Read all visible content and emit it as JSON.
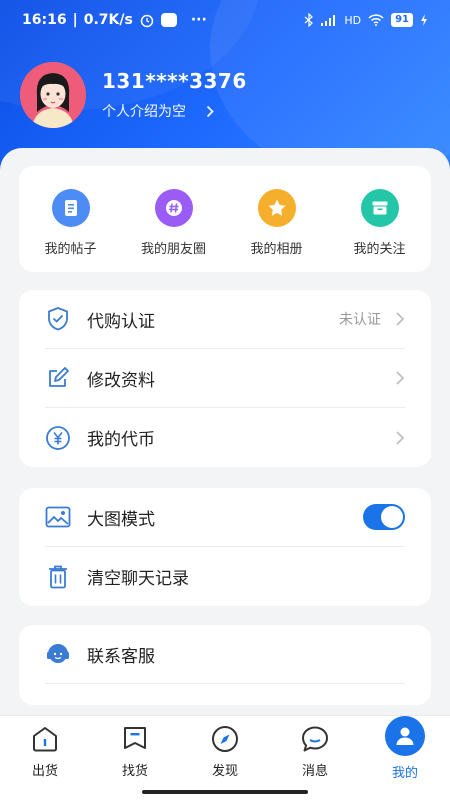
{
  "statusbar": {
    "time": "16:16",
    "speed": "0.7K/s",
    "battery": "91",
    "more": "···",
    "net": "HD"
  },
  "profile": {
    "name": "131****3376",
    "bio": "个人介绍为空"
  },
  "quick_actions": [
    {
      "label": "我的帖子",
      "icon": "document-icon",
      "color": "#4d8bf5"
    },
    {
      "label": "我的朋友圈",
      "icon": "hashtag-icon",
      "color": "#9b5cf6"
    },
    {
      "label": "我的相册",
      "icon": "star-icon",
      "color": "#f6ae2d"
    },
    {
      "label": "我的关注",
      "icon": "archive-icon",
      "color": "#24c6a8"
    }
  ],
  "account_list": [
    {
      "label": "代购认证",
      "value": "未认证",
      "icon": "shield-check-icon"
    },
    {
      "label": "修改资料",
      "value": "",
      "icon": "edit-icon"
    },
    {
      "label": "我的代币",
      "value": "",
      "icon": "coin-icon"
    }
  ],
  "settings_list": [
    {
      "label": "大图模式",
      "icon": "image-icon",
      "toggle": true
    },
    {
      "label": "清空聊天记录",
      "icon": "trash-icon"
    }
  ],
  "support_list": [
    {
      "label": "联系客服",
      "icon": "headset-icon"
    }
  ],
  "tabs": [
    {
      "label": "出货",
      "icon": "home-icon"
    },
    {
      "label": "找货",
      "icon": "bookmark-icon"
    },
    {
      "label": "发现",
      "icon": "compass-icon"
    },
    {
      "label": "消息",
      "icon": "chat-icon"
    },
    {
      "label": "我的",
      "icon": "user-icon",
      "active": true
    }
  ],
  "colors": {
    "primary": "#1a73e8",
    "header": "#1f6bff"
  }
}
